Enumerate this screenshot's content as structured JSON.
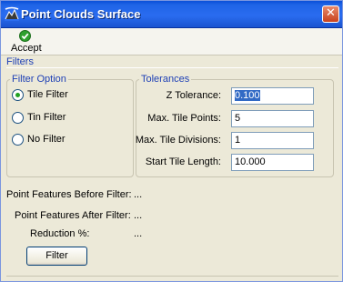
{
  "window": {
    "title": "Point Clouds Surface",
    "close_glyph": "✕"
  },
  "toolbar": {
    "accept_label": "Accept",
    "accept_icon": "check-circle-icon"
  },
  "filters": {
    "section_label": "Filters",
    "filter_option": {
      "legend": "Filter Option",
      "options": [
        {
          "label": "Tile Filter",
          "checked": true
        },
        {
          "label": "Tin Filter",
          "checked": false
        },
        {
          "label": "No Filter",
          "checked": false
        }
      ]
    },
    "tolerances": {
      "legend": "Tolerances",
      "fields": [
        {
          "label": "Z Tolerance:",
          "value": "0.100"
        },
        {
          "label": "Max. Tile Points:",
          "value": "5"
        },
        {
          "label": "Max. Tile Divisions:",
          "value": "1"
        },
        {
          "label": "Start Tile Length:",
          "value": "10.000"
        }
      ]
    }
  },
  "stats": [
    {
      "label": "Point Features Before Filter:",
      "value": "..."
    },
    {
      "label": "Point Features After Filter:",
      "value": "..."
    },
    {
      "label": "Reduction %:",
      "value": "..."
    }
  ],
  "filter_button_label": "Filter",
  "colors": {
    "titlebar": "#2a6cf0",
    "group_label": "#1d3fb5",
    "radio_dot": "#21a121",
    "selection": "#316ac5"
  }
}
